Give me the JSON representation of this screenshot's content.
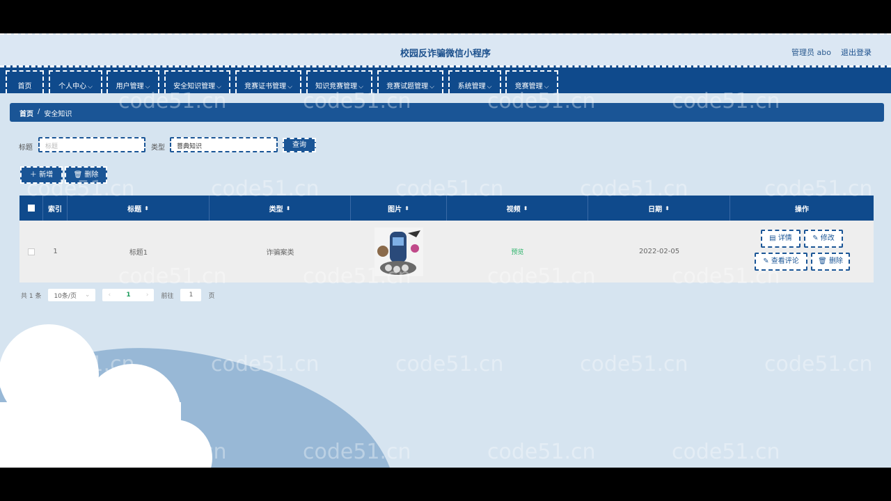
{
  "header": {
    "title": "校园反诈骗微信小程序",
    "user_label": "管理员 abo",
    "logout_label": "退出登录"
  },
  "nav": {
    "items": [
      {
        "label": "首页",
        "has_dropdown": false
      },
      {
        "label": "个人中心",
        "has_dropdown": true
      },
      {
        "label": "用户管理",
        "has_dropdown": true
      },
      {
        "label": "安全知识管理",
        "has_dropdown": true
      },
      {
        "label": "竞赛证书管理",
        "has_dropdown": true
      },
      {
        "label": "知识竞赛管理",
        "has_dropdown": true
      },
      {
        "label": "竞赛试题管理",
        "has_dropdown": true
      },
      {
        "label": "系统管理",
        "has_dropdown": true
      },
      {
        "label": "竞赛管理",
        "has_dropdown": true
      }
    ],
    "arrow": "⌵"
  },
  "breadcrumb": {
    "home": "首页",
    "separator": "/",
    "current": "安全知识"
  },
  "search": {
    "title_label": "标题",
    "title_placeholder": "标题",
    "type_label": "类型",
    "type_value": "菩典知识",
    "search_button": "查询"
  },
  "toolbar": {
    "add_label": "＋ 新增",
    "delete_label": "🗑 删除"
  },
  "table": {
    "headers": [
      "索引",
      "标题",
      "类型",
      "图片",
      "视频",
      "日期",
      "操作"
    ],
    "sort_icon": "⬍",
    "rows": [
      {
        "index": "1",
        "title": "标题1",
        "type": "诈骗案类",
        "video": "预览",
        "date": "2022-02-05"
      }
    ],
    "actions": {
      "detail": "详情",
      "edit": "修改",
      "comments": "查看评论",
      "delete": "删除"
    }
  },
  "pager": {
    "total": "共 1 条",
    "page_size": "10条/页",
    "current_page": "1",
    "goto_label": "前往",
    "goto_value": "1",
    "page_suffix": "页"
  },
  "watermark": "code51.cn",
  "colors": {
    "primary": "#0f4a8c",
    "background": "#d6e4f0",
    "accent_green": "#2bb36a"
  }
}
